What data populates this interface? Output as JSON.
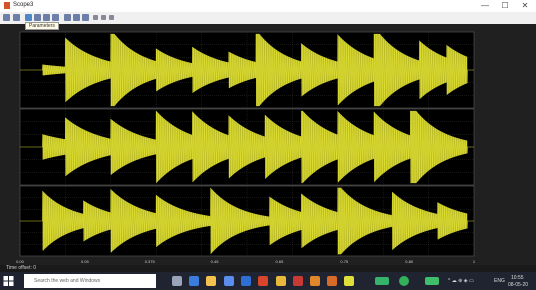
{
  "window": {
    "title": "Scope3",
    "minimize": "—",
    "maximize": "☐",
    "close": "✕"
  },
  "toolbar": {
    "tooltip": "Parameters",
    "icons": [
      "print-icon",
      "settings-icon",
      "zoom-in-icon",
      "zoom-x-icon",
      "zoom-y-icon",
      "autoscale-icon",
      "save-axes-icon",
      "restore-axes-icon",
      "floating-scope-icon",
      "lock-axes-icon",
      "legend-icon",
      "pan-icon"
    ]
  },
  "chart_data": {
    "type": "line",
    "series_color": "#dede32",
    "xlim": [
      0,
      1
    ],
    "ylim": [
      -1,
      1
    ],
    "x_tick_labels": [
      "0.00",
      "0.05",
      "0.375",
      "0.45",
      "0.65",
      "0.75",
      "0.80",
      "1"
    ],
    "panels": [
      {
        "bursts": [
          {
            "x": 0.05,
            "amp": 0.15,
            "decay": 10
          },
          {
            "x": 0.1,
            "amp": 0.8,
            "decay": 14
          },
          {
            "x": 0.2,
            "amp": 0.9,
            "decay": 16
          },
          {
            "x": 0.3,
            "amp": 0.35,
            "decay": 14
          },
          {
            "x": 0.38,
            "amp": 0.45,
            "decay": 14
          },
          {
            "x": 0.46,
            "amp": 0.3,
            "decay": 14
          },
          {
            "x": 0.52,
            "amp": 0.9,
            "decay": 16
          },
          {
            "x": 0.62,
            "amp": 0.5,
            "decay": 14
          },
          {
            "x": 0.7,
            "amp": 0.75,
            "decay": 14
          },
          {
            "x": 0.78,
            "amp": 0.9,
            "decay": 16
          },
          {
            "x": 0.88,
            "amp": 0.55,
            "decay": 14
          },
          {
            "x": 0.94,
            "amp": 0.35,
            "decay": 14
          }
        ]
      },
      {
        "bursts": [
          {
            "x": 0.05,
            "amp": 0.35,
            "decay": 10
          },
          {
            "x": 0.1,
            "amp": 0.6,
            "decay": 14
          },
          {
            "x": 0.2,
            "amp": 0.55,
            "decay": 14
          },
          {
            "x": 0.3,
            "amp": 0.8,
            "decay": 14
          },
          {
            "x": 0.38,
            "amp": 0.65,
            "decay": 14
          },
          {
            "x": 0.46,
            "amp": 0.55,
            "decay": 14
          },
          {
            "x": 0.54,
            "amp": 0.6,
            "decay": 14
          },
          {
            "x": 0.62,
            "amp": 0.75,
            "decay": 14
          },
          {
            "x": 0.7,
            "amp": 0.65,
            "decay": 14
          },
          {
            "x": 0.78,
            "amp": 0.65,
            "decay": 14
          },
          {
            "x": 0.86,
            "amp": 0.9,
            "decay": 16
          }
        ]
      },
      {
        "bursts": [
          {
            "x": 0.05,
            "amp": 0.9,
            "decay": 16
          },
          {
            "x": 0.14,
            "amp": 0.4,
            "decay": 14
          },
          {
            "x": 0.2,
            "amp": 0.7,
            "decay": 14
          },
          {
            "x": 0.3,
            "amp": 0.55,
            "decay": 14
          },
          {
            "x": 0.42,
            "amp": 0.85,
            "decay": 16
          },
          {
            "x": 0.55,
            "amp": 0.6,
            "decay": 14
          },
          {
            "x": 0.62,
            "amp": 0.55,
            "decay": 14
          },
          {
            "x": 0.7,
            "amp": 0.85,
            "decay": 16
          },
          {
            "x": 0.82,
            "amp": 0.7,
            "decay": 14
          },
          {
            "x": 0.92,
            "amp": 0.35,
            "decay": 14
          }
        ]
      }
    ]
  },
  "statusbar": {
    "text": "Time offset: 0"
  },
  "taskbar": {
    "search_placeholder": "Search the web and Windows",
    "apps": [
      {
        "icon": "task-view-icon",
        "color": "#9aa4b8"
      },
      {
        "icon": "edge-icon",
        "color": "#3b7ddd"
      },
      {
        "icon": "file-explorer-icon",
        "color": "#f2c14e"
      },
      {
        "icon": "store-icon",
        "color": "#5a8dee"
      },
      {
        "icon": "mail-icon",
        "color": "#2f6fd1"
      },
      {
        "icon": "office-icon",
        "color": "#d9452b"
      },
      {
        "icon": "chrome-icon",
        "color": "#e8b93a"
      },
      {
        "icon": "pdf-icon",
        "color": "#c83b35"
      },
      {
        "icon": "media-icon",
        "color": "#e0872b"
      },
      {
        "icon": "matlab-icon",
        "color": "#d86b2a"
      },
      {
        "icon": "scope-icon",
        "color": "#dfdf3a"
      },
      {
        "icon": "battery-app-icon",
        "color": "#35b36a"
      },
      {
        "icon": "green-circle-app-icon",
        "color": "#32b05a"
      },
      {
        "icon": "battery-icon",
        "color": "#3fbf6c"
      }
    ],
    "tray_text": "^ ☁ ⊕ ◈ ▭",
    "lang": "ENG",
    "time": "10:55",
    "date": "08-05-20"
  }
}
